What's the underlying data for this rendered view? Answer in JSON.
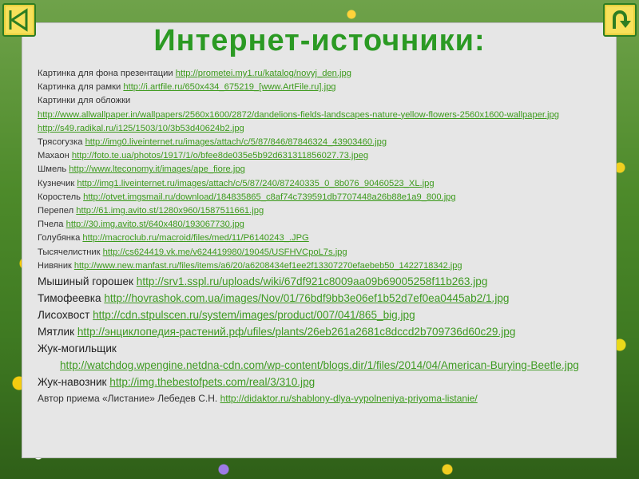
{
  "title": "Интернет-источники:",
  "colors": {
    "title": "#2b9a23",
    "link": "#3c9a1c",
    "button_bg": "#f7e15a",
    "button_border": "#2d7d22"
  },
  "nav": {
    "back_icon": "back-triangle-icon",
    "return_icon": "u-turn-arrow-icon"
  },
  "lines": [
    {
      "label": "Картинка для фона презентации",
      "url": "http://prometei.my1.ru/katalog/novyj_den.jpg"
    },
    {
      "label": "Картинка для рамки",
      "url": "http://i.artfile.ru/650x434_675219_[www.ArtFile.ru].jpg"
    },
    {
      "label": "Картинки для обложки",
      "url": ""
    },
    {
      "label": "",
      "url": "http://www.allwallpaper.in/wallpapers/2560x1600/2872/dandelions-fields-landscapes-nature-yellow-flowers-2560x1600-wallpaper.jpg"
    },
    {
      "label": "",
      "url": "http://s49.radikal.ru/i125/1503/10/3b53d40624b2.jpg"
    },
    {
      "label": "Трясогузка",
      "url": "http://img0.liveinternet.ru/images/attach/c/5/87/846/87846324_43903460.jpg"
    },
    {
      "label": "Махаон",
      "url": "http://foto.te.ua/photos/1917/1/o/bfee8de035e5b92d631311856027.73.jpeg"
    },
    {
      "label": "Шмель",
      "url": "http://www.lteconomy.it/images/ape_fiore.jpg"
    },
    {
      "label": "Кузнечик",
      "url": "http://img1.liveinternet.ru/images/attach/c/5/87/240/87240335_0_8b076_90460523_XL.jpg"
    },
    {
      "label": "Коростель",
      "url": "http://otvet.imgsmail.ru/download/184835865_c8af74c739591db7707448a26b88e1a9_800.jpg"
    },
    {
      "label": "Перепел",
      "url": "http://61.img.avito.st/1280x960/1587511661.jpg"
    },
    {
      "label": "Пчела",
      "url": "http://30.img.avito.st/640x480/193067730.jpg"
    },
    {
      "label": "Голубянка",
      "url": "http://macroclub.ru/macroid/files/med/11/P6140243_.JPG"
    },
    {
      "label": "Тысячелистник",
      "url": "http://cs624419.vk.me/v624419980/19045/USFHVCpoL7s.jpg"
    },
    {
      "label": "Нивяник",
      "url": "http://www.new.manfast.ru/files/items/a6/20/a6208434ef1ee2f13307270efaebeb50_1422718342.jpg"
    },
    {
      "label": "Мышиный горошек",
      "url": "http://srv1.sspl.ru/uploads/wiki/67df921c8009aa09b69005258f11b263.jpg"
    },
    {
      "label": "Тимофеевка",
      "url": "http://hovrashok.com.ua/images/Nov/01/76bdf9bb3e06ef1b52d7ef0ea0445ab2/1.jpg"
    },
    {
      "label": "Лисохвост",
      "url": "http://cdn.stpulscen.ru/system/images/product/007/041/865_big.jpg"
    },
    {
      "label": "Мятлик",
      "url": "http://энциклопедия-растений.рф/ufiles/plants/26eb261a2681c8dccd2b709736d60c29.jpg"
    },
    {
      "label": "Жук-могильщик",
      "url": ""
    },
    {
      "label": "",
      "url": "http://watchdog.wpengine.netdna-cdn.com/wp-content/blogs.dir/1/files/2014/04/American-Burying-Beetle.jpg"
    },
    {
      "label": "Жук-навозник",
      "url": "http://img.thebestofpets.com/real/3/310.jpg"
    },
    {
      "label": "Автор приема «Листание» Лебедев С.Н.",
      "url": "http://didaktor.ru/shablony-dlya-vypolneniya-priyoma-listanie/"
    }
  ]
}
